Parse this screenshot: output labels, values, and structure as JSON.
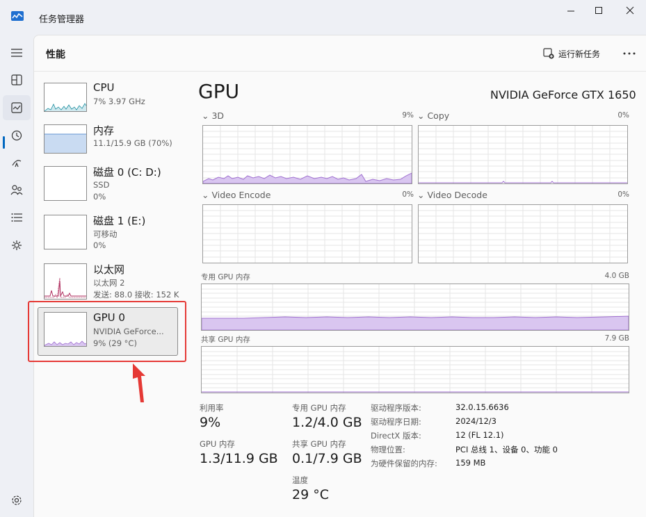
{
  "app": {
    "title": "任务管理器"
  },
  "header": {
    "title": "性能",
    "run_task_label": "运行新任务"
  },
  "devices": [
    {
      "name": "CPU",
      "line1": "7% 3.97 GHz",
      "line2": ""
    },
    {
      "name": "内存",
      "line1": "11.1/15.9 GB (70%)",
      "line2": ""
    },
    {
      "name": "磁盘 0 (C: D:)",
      "line1": "SSD",
      "line2": "0%"
    },
    {
      "name": "磁盘 1 (E:)",
      "line1": "可移动",
      "line2": "0%"
    },
    {
      "name": "以太网",
      "line1": "以太网 2",
      "line2": "发送: 88.0  接收: 152 K"
    },
    {
      "name": "GPU 0",
      "line1": "NVIDIA GeForce...",
      "line2": "9% (29 °C)"
    }
  ],
  "gpu": {
    "title": "GPU",
    "model": "NVIDIA GeForce GTX 1650",
    "engines": [
      {
        "name": "3D",
        "percent": "9%"
      },
      {
        "name": "Copy",
        "percent": "0%"
      },
      {
        "name": "Video Encode",
        "percent": "0%"
      },
      {
        "name": "Video Decode",
        "percent": "0%"
      }
    ],
    "dedicated_memory": {
      "label": "专用 GPU 内存",
      "max": "4.0 GB"
    },
    "shared_memory": {
      "label": "共享 GPU 内存",
      "max": "7.9 GB"
    },
    "stats": {
      "utilization_label": "利用率",
      "utilization": "9%",
      "dedicated_label": "专用 GPU 内存",
      "dedicated": "1.2/4.0 GB",
      "gpu_mem_label": "GPU 内存",
      "gpu_mem": "1.3/11.9 GB",
      "shared_label": "共享 GPU 内存",
      "shared": "0.1/7.9 GB",
      "temp_label": "温度",
      "temp": "29 °C"
    },
    "info": [
      {
        "key": "驱动程序版本:",
        "value": "32.0.15.6636"
      },
      {
        "key": "驱动程序日期:",
        "value": "2024/12/3"
      },
      {
        "key": "DirectX 版本:",
        "value": "12 (FL 12.1)"
      },
      {
        "key": "物理位置:",
        "value": "PCI 总线 1、设备 0、功能 0"
      },
      {
        "key": "为硬件保留的内存:",
        "value": "159 MB"
      }
    ]
  },
  "colors": {
    "gpu": "#a070d0",
    "gpu_fill": "#d9c6f0",
    "memory": "#6496d2",
    "memory_fill": "#c9dbf2",
    "ethernet": "#b03060",
    "cpu": "#1e8fa0",
    "annotation": "#e53935"
  },
  "icons": [
    "app-icon",
    "minimize-icon",
    "maximize-icon",
    "close-icon",
    "hamburger-icon",
    "processes-icon",
    "performance-icon",
    "app-history-icon",
    "startup-icon",
    "users-icon",
    "details-icon",
    "services-icon",
    "settings-icon",
    "run-task-icon",
    "more-icon",
    "arrow-annotation"
  ]
}
